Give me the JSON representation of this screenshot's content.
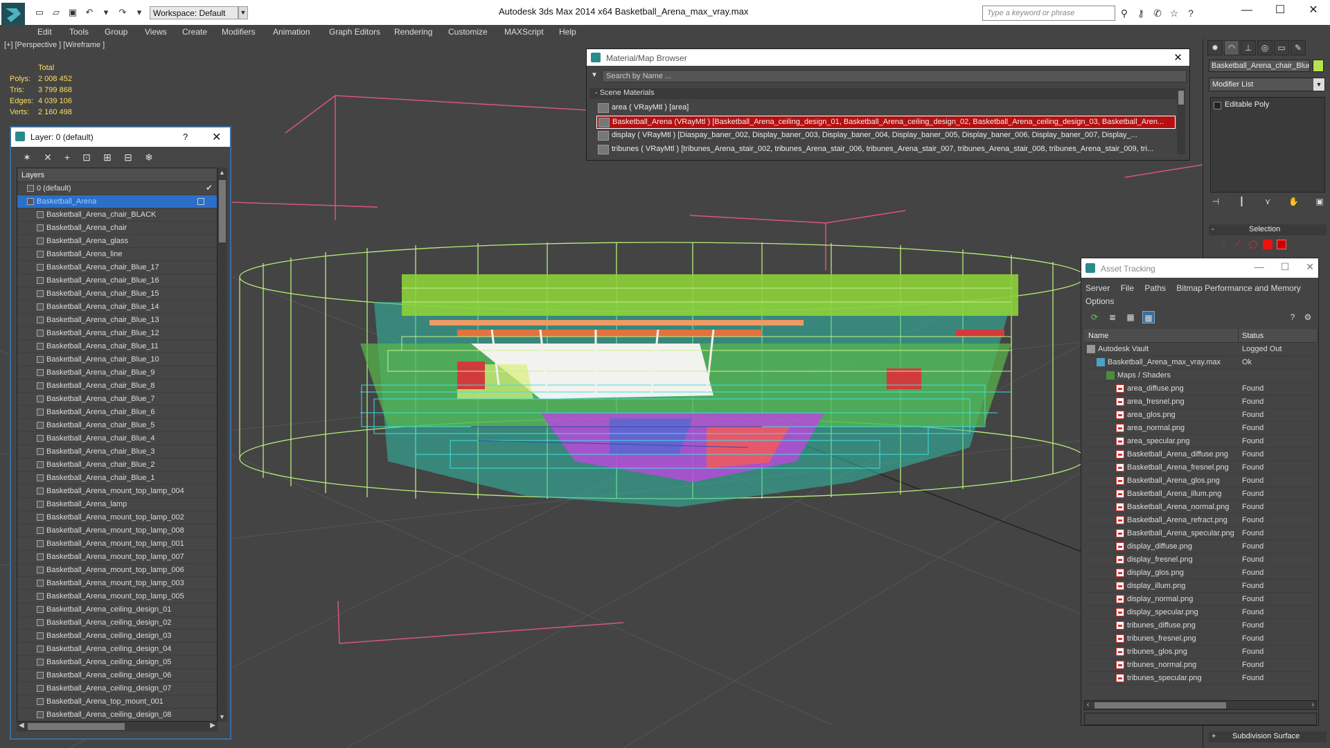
{
  "titlebar": {
    "workspace": "Workspace: Default",
    "app_title": "Autodesk 3ds Max  2014 x64     Basketball_Arena_max_vray.max",
    "search_placeholder": "Type a keyword or phrase"
  },
  "menu": [
    "Edit",
    "Tools",
    "Group",
    "Views",
    "Create",
    "Modifiers",
    "Animation",
    "Graph Editors",
    "Rendering",
    "Customize",
    "MAXScript",
    "Help"
  ],
  "viewport": {
    "label": "[+] [Perspective ] [Wireframe ]",
    "stats": {
      "header": "Total",
      "rows": [
        {
          "k": "Polys:",
          "v": "2 008 452"
        },
        {
          "k": "Tris:",
          "v": "3 799 868"
        },
        {
          "k": "Edges:",
          "v": "4 039 106"
        },
        {
          "k": "Verts:",
          "v": "2 160 498"
        }
      ]
    }
  },
  "layer_dialog": {
    "title": "Layer: 0 (default)",
    "help": "?",
    "column": "Layers",
    "top_layers": [
      "0 (default)",
      "Basketball_Arena"
    ],
    "children": [
      "Basketball_Arena_chair_BLACK",
      "Basketball_Arena_chair",
      "Basketball_Arena_glass",
      "Basketball_Arena_line",
      "Basketball_Arena_chair_Blue_17",
      "Basketball_Arena_chair_Blue_16",
      "Basketball_Arena_chair_Blue_15",
      "Basketball_Arena_chair_Blue_14",
      "Basketball_Arena_chair_Blue_13",
      "Basketball_Arena_chair_Blue_12",
      "Basketball_Arena_chair_Blue_11",
      "Basketball_Arena_chair_Blue_10",
      "Basketball_Arena_chair_Blue_9",
      "Basketball_Arena_chair_Blue_8",
      "Basketball_Arena_chair_Blue_7",
      "Basketball_Arena_chair_Blue_6",
      "Basketball_Arena_chair_Blue_5",
      "Basketball_Arena_chair_Blue_4",
      "Basketball_Arena_chair_Blue_3",
      "Basketball_Arena_chair_Blue_2",
      "Basketball_Arena_chair_Blue_1",
      "Basketball_Arena_mount_top_lamp_004",
      "Basketball_Arena_lamp",
      "Basketball_Arena_mount_top_lamp_002",
      "Basketball_Arena_mount_top_lamp_008",
      "Basketball_Arena_mount_top_lamp_001",
      "Basketball_Arena_mount_top_lamp_007",
      "Basketball_Arena_mount_top_lamp_006",
      "Basketball_Arena_mount_top_lamp_003",
      "Basketball_Arena_mount_top_lamp_005",
      "Basketball_Arena_ceiling_design_01",
      "Basketball_Arena_ceiling_design_02",
      "Basketball_Arena_ceiling_design_03",
      "Basketball_Arena_ceiling_design_04",
      "Basketball_Arena_ceiling_design_05",
      "Basketball_Arena_ceiling_design_06",
      "Basketball_Arena_ceiling_design_07",
      "Basketball_Arena_top_mount_001",
      "Basketball_Arena_ceiling_design_08"
    ]
  },
  "material_browser": {
    "title": "Material/Map Browser",
    "search_placeholder": "Search by Name ...",
    "section": "- Scene Materials",
    "rows": [
      "area  ( VRayMtl )  [area]",
      "Basketball_Arena  (VRayMtl ) [Basketball_Arena_ceiling_design_01, Basketball_Arena_ceiling_design_02, Basketball_Arena_ceiling_design_03, Basketball_Aren...",
      "display  ( VRayMtl ) [Diaspay_baner_002, Display_baner_003, Display_baner_004, Display_baner_005, Display_baner_006, Display_baner_007, Display_...",
      "tribunes  ( VRayMtl ) [tribunes_Arena_stair_002, tribunes_Arena_stair_006, tribunes_Arena_stair_007, tribunes_Arena_stair_008, tribunes_Arena_stair_009, tri..."
    ]
  },
  "command_panel": {
    "object_name": "Basketball_Arena_chair_Blue_",
    "object_color": "#b7e34d",
    "modifier_list": "Modifier List",
    "stack_item": "Editable Poly",
    "selection_rollout": "Selection",
    "subdiv_rollout": "Subdivision Surface"
  },
  "asset_tracking": {
    "title": "Asset Tracking",
    "menu": [
      "Server",
      "File",
      "Paths",
      "Bitmap Performance and Memory",
      "Options"
    ],
    "col_name": "Name",
    "col_status": "Status",
    "rows": [
      {
        "name": "Autodesk Vault",
        "status": "Logged Out",
        "level": 0,
        "icon": "vault"
      },
      {
        "name": "Basketball_Arena_max_vray.max",
        "status": "Ok",
        "level": 1,
        "icon": "max"
      },
      {
        "name": "Maps / Shaders",
        "status": "",
        "level": 2,
        "icon": "maps"
      },
      {
        "name": "area_diffuse.png",
        "status": "Found",
        "level": 3,
        "icon": "png"
      },
      {
        "name": "area_fresnel.png",
        "status": "Found",
        "level": 3,
        "icon": "png"
      },
      {
        "name": "area_glos.png",
        "status": "Found",
        "level": 3,
        "icon": "png"
      },
      {
        "name": "area_normal.png",
        "status": "Found",
        "level": 3,
        "icon": "png"
      },
      {
        "name": "area_specular.png",
        "status": "Found",
        "level": 3,
        "icon": "png"
      },
      {
        "name": "Basketball_Arena_diffuse.png",
        "status": "Found",
        "level": 3,
        "icon": "png"
      },
      {
        "name": "Basketball_Arena_fresnel.png",
        "status": "Found",
        "level": 3,
        "icon": "png"
      },
      {
        "name": "Basketball_Arena_glos.png",
        "status": "Found",
        "level": 3,
        "icon": "png"
      },
      {
        "name": "Basketball_Arena_illum.png",
        "status": "Found",
        "level": 3,
        "icon": "png"
      },
      {
        "name": "Basketball_Arena_normal.png",
        "status": "Found",
        "level": 3,
        "icon": "png"
      },
      {
        "name": "Basketball_Arena_refract.png",
        "status": "Found",
        "level": 3,
        "icon": "png"
      },
      {
        "name": "Basketball_Arena_specular.png",
        "status": "Found",
        "level": 3,
        "icon": "png"
      },
      {
        "name": "display_diffuse.png",
        "status": "Found",
        "level": 3,
        "icon": "png"
      },
      {
        "name": "display_fresnel.png",
        "status": "Found",
        "level": 3,
        "icon": "png"
      },
      {
        "name": "display_glos.png",
        "status": "Found",
        "level": 3,
        "icon": "png"
      },
      {
        "name": "display_illum.png",
        "status": "Found",
        "level": 3,
        "icon": "png"
      },
      {
        "name": "display_normal.png",
        "status": "Found",
        "level": 3,
        "icon": "png"
      },
      {
        "name": "display_specular.png",
        "status": "Found",
        "level": 3,
        "icon": "png"
      },
      {
        "name": "tribunes_diffuse.png",
        "status": "Found",
        "level": 3,
        "icon": "png"
      },
      {
        "name": "tribunes_fresnel.png",
        "status": "Found",
        "level": 3,
        "icon": "png"
      },
      {
        "name": "tribunes_glos.png",
        "status": "Found",
        "level": 3,
        "icon": "png"
      },
      {
        "name": "tribunes_normal.png",
        "status": "Found",
        "level": 3,
        "icon": "png"
      },
      {
        "name": "tribunes_specular.png",
        "status": "Found",
        "level": 3,
        "icon": "png"
      }
    ]
  }
}
